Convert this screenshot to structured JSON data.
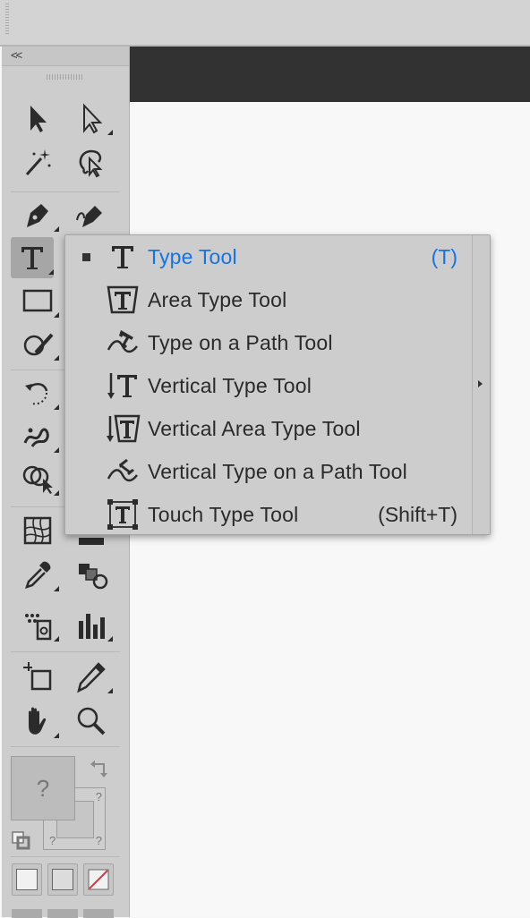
{
  "toolbar": {
    "collapse_label": "<<",
    "tools": [
      {
        "name": "selection-tool",
        "icon": "selection-arrow-icon"
      },
      {
        "name": "direct-selection-tool",
        "icon": "direct-selection-arrow-icon"
      },
      {
        "name": "magic-wand-tool",
        "icon": "magic-wand-icon"
      },
      {
        "name": "lasso-tool",
        "icon": "lasso-icon"
      },
      {
        "name": "pen-tool",
        "icon": "pen-icon"
      },
      {
        "name": "curvature-tool",
        "icon": "curvature-pen-icon"
      },
      {
        "name": "type-tool",
        "icon": "type-icon",
        "selected": true
      },
      {
        "name": "line-segment-tool",
        "icon": "line-icon"
      },
      {
        "name": "rectangle-tool",
        "icon": "rectangle-icon"
      },
      {
        "name": "paintbrush-tool",
        "icon": "paintbrush-icon"
      },
      {
        "name": "shaper-tool",
        "icon": "shaper-icon"
      },
      {
        "name": "rotate-tool",
        "icon": "rotate-icon"
      },
      {
        "name": "scale-tool",
        "icon": "scale-icon"
      },
      {
        "name": "puppet-warp-tool",
        "icon": "puppet-warp-icon"
      },
      {
        "name": "free-transform-tool",
        "icon": "free-transform-icon"
      },
      {
        "name": "shape-builder-tool",
        "icon": "shape-builder-icon"
      },
      {
        "name": "perspective-grid-tool",
        "icon": "perspective-grid-icon"
      },
      {
        "name": "mesh-tool",
        "icon": "mesh-icon"
      },
      {
        "name": "gradient-tool",
        "icon": "gradient-icon"
      },
      {
        "name": "eyedropper-tool",
        "icon": "eyedropper-icon"
      },
      {
        "name": "blend-tool",
        "icon": "blend-icon"
      },
      {
        "name": "symbol-sprayer-tool",
        "icon": "symbol-sprayer-icon"
      },
      {
        "name": "column-graph-tool",
        "icon": "column-graph-icon"
      },
      {
        "name": "artboard-tool",
        "icon": "artboard-icon"
      },
      {
        "name": "slice-tool",
        "icon": "slice-icon"
      },
      {
        "name": "hand-tool",
        "icon": "hand-icon"
      },
      {
        "name": "zoom-tool",
        "icon": "zoom-icon"
      }
    ],
    "fill_label": "?",
    "stroke_label": "?",
    "stroke_q1": "?",
    "stroke_q2": "?"
  },
  "flyout": {
    "items": [
      {
        "label": "Type Tool",
        "shortcut": "(T)",
        "icon": "type-icon",
        "active": true
      },
      {
        "label": "Area Type Tool",
        "shortcut": "",
        "icon": "area-type-icon"
      },
      {
        "label": "Type on a Path Tool",
        "shortcut": "",
        "icon": "type-on-path-icon"
      },
      {
        "label": "Vertical Type Tool",
        "shortcut": "",
        "icon": "vertical-type-icon"
      },
      {
        "label": "Vertical Area Type Tool",
        "shortcut": "",
        "icon": "vertical-area-type-icon"
      },
      {
        "label": "Vertical Type on a Path Tool",
        "shortcut": "",
        "icon": "vertical-type-on-path-icon"
      },
      {
        "label": "Touch Type Tool",
        "shortcut": "(Shift+T)",
        "icon": "touch-type-icon"
      }
    ],
    "active_color": "#1473e6"
  }
}
